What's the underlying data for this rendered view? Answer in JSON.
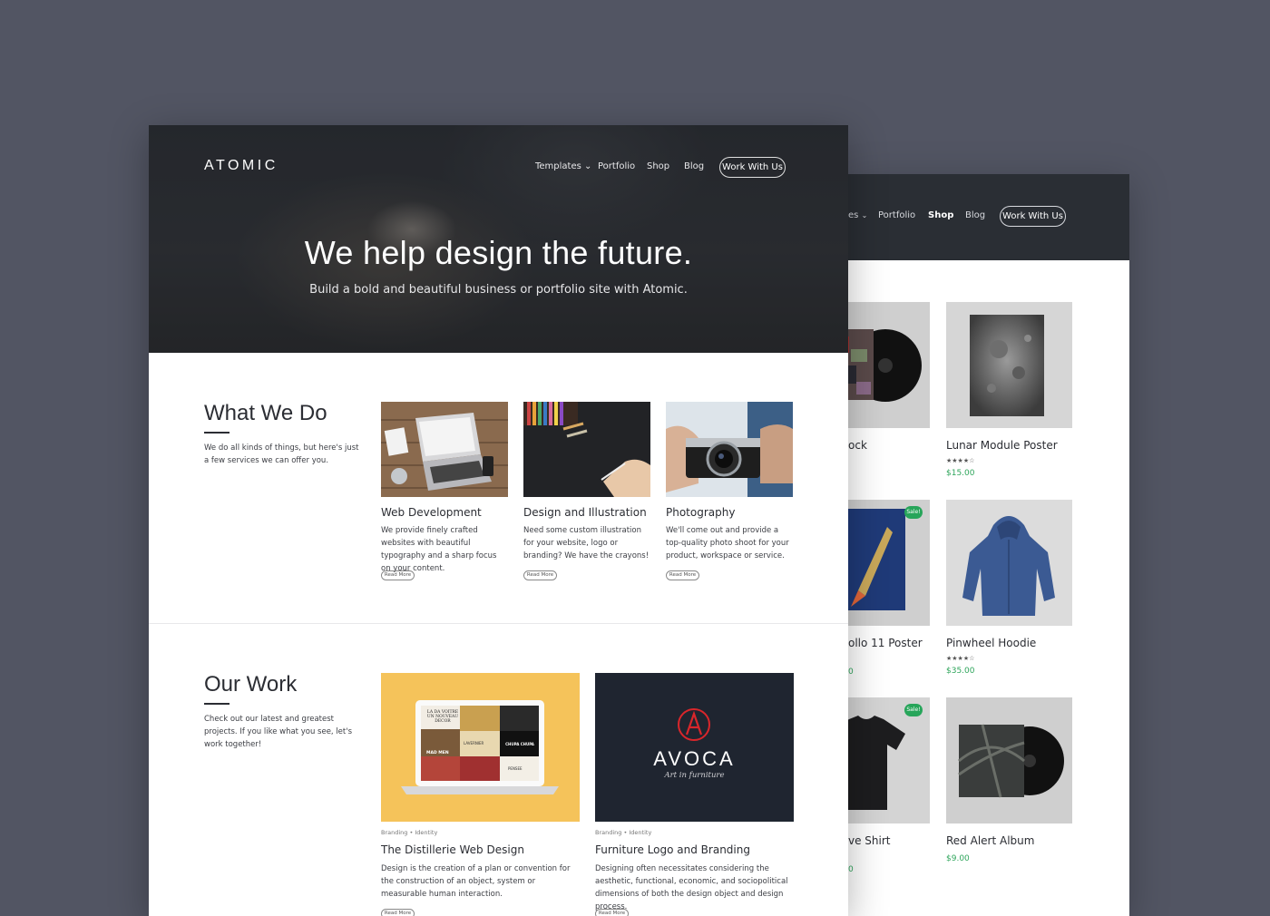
{
  "shop": {
    "nav": {
      "templates_partial": "es",
      "chevron": "⌄",
      "portfolio": "Portfolio",
      "shop": "Shop",
      "blog": "Blog",
      "cta": "Work With Us"
    },
    "products": [
      {
        "name": "ock",
        "price": "",
        "rating": "",
        "sale": "",
        "image": "record-album-icon"
      },
      {
        "name": "Lunar Module Poster",
        "price": "$15.00",
        "rating": "★★★★☆",
        "sale": "",
        "image": "moon-poster-icon"
      },
      {
        "name": "ollo 11 Poster",
        "price": "0",
        "rating": "",
        "sale": "Sale!",
        "image": "rocket-poster-icon"
      },
      {
        "name": "Pinwheel Hoodie",
        "price": "$35.00",
        "rating": "★★★★☆",
        "sale": "",
        "image": "hoodie-icon"
      },
      {
        "name": "ve Shirt",
        "price": "0",
        "rating": "",
        "sale": "Sale!",
        "image": "tshirt-icon"
      },
      {
        "name": "Red Alert Album",
        "price": "$9.00",
        "rating": "",
        "sale": "",
        "image": "record-album-icon"
      }
    ]
  },
  "front": {
    "logo": "ATOMIC",
    "nav": {
      "templates": "Templates ⌄",
      "portfolio": "Portfolio",
      "shop": "Shop",
      "blog": "Blog",
      "cta": "Work With Us"
    },
    "hero": {
      "title": "We help design the future.",
      "subtitle": "Build a bold and beautiful business or portfolio site with Atomic."
    },
    "what_we_do": {
      "title": "What We Do",
      "description": "We do all kinds of things, but here's just a few services we can offer you.",
      "services": [
        {
          "title": "Web Development",
          "text": "We provide finely crafted websites with beautiful typography and a sharp focus on your content.",
          "button": "Read More"
        },
        {
          "title": "Design and Illustration",
          "text": "Need some custom illustration for your website, logo or branding? We have the crayons!",
          "button": "Read More"
        },
        {
          "title": "Photography",
          "text": "We'll come out and provide a top-quality photo shoot for your product, workspace or service.",
          "button": "Read More"
        }
      ]
    },
    "our_work": {
      "title": "Our Work",
      "description": "Check out our latest and greatest projects. If you like what you see, let's work together!",
      "projects": [
        {
          "category": "Branding • Identity",
          "title": "The Distillerie Web Design",
          "text": "Design is the creation of a plan or convention for the construction of an object, system or measurable human interaction.",
          "button": "Read More",
          "screen_lines": [
            "LA DA VOITRE",
            "UN NOUVEAU",
            "DECOR"
          ],
          "tile_labels": [
            "MAD MEN",
            "LAVERNIER",
            "CHUPA CHUPA",
            "PENSEE"
          ]
        },
        {
          "category": "Branding • Identity",
          "title": "Furniture Logo and Branding",
          "text": "Designing often necessitates considering the aesthetic, functional, economic, and sociopolitical dimensions of both the design object and design process.",
          "button": "Read More",
          "logo_word": "AVOCA",
          "logo_tagline": "Art in furniture"
        }
      ]
    }
  },
  "colors": {
    "background": "#525563",
    "header_dark": "#2a2e34",
    "price_green": "#2ea55b",
    "distillerie_yellow": "#f5c35a",
    "avoca_navy": "#1f2530",
    "avoca_red": "#d9262b"
  }
}
